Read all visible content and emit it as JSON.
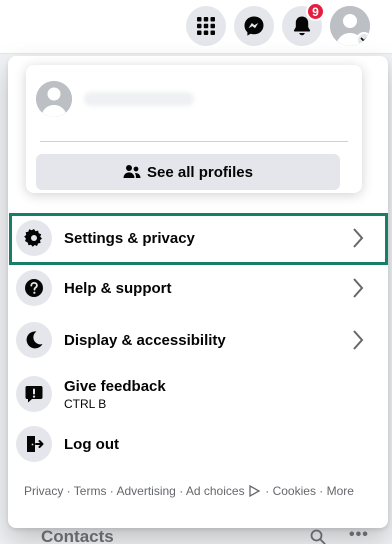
{
  "topbar": {
    "icons": [
      "menu-grid-icon",
      "messenger-icon",
      "bell-icon",
      "account-avatar"
    ],
    "notification_count": "9"
  },
  "profile_card": {
    "see_all_label": "See all profiles"
  },
  "menu_items": [
    {
      "label": "Settings & privacy",
      "icon": "gear-icon"
    },
    {
      "label": "Help & support",
      "icon": "question-icon"
    },
    {
      "label": "Display & accessibility",
      "icon": "moon-icon"
    },
    {
      "label": "Give feedback",
      "sublabel": "CTRL B",
      "icon": "feedback-icon"
    },
    {
      "label": "Log out",
      "icon": "logout-icon"
    }
  ],
  "footer": {
    "links": [
      "Privacy",
      "Terms",
      "Advertising",
      "Ad choices",
      "Cookies",
      "More"
    ],
    "separator": " · "
  },
  "contacts": {
    "title": "Contacts"
  },
  "colors": {
    "highlight_border": "#1a7d6a",
    "badge": "#e41e3f",
    "menu_bg": "#ffffff",
    "button_bg": "#e4e6eb"
  }
}
